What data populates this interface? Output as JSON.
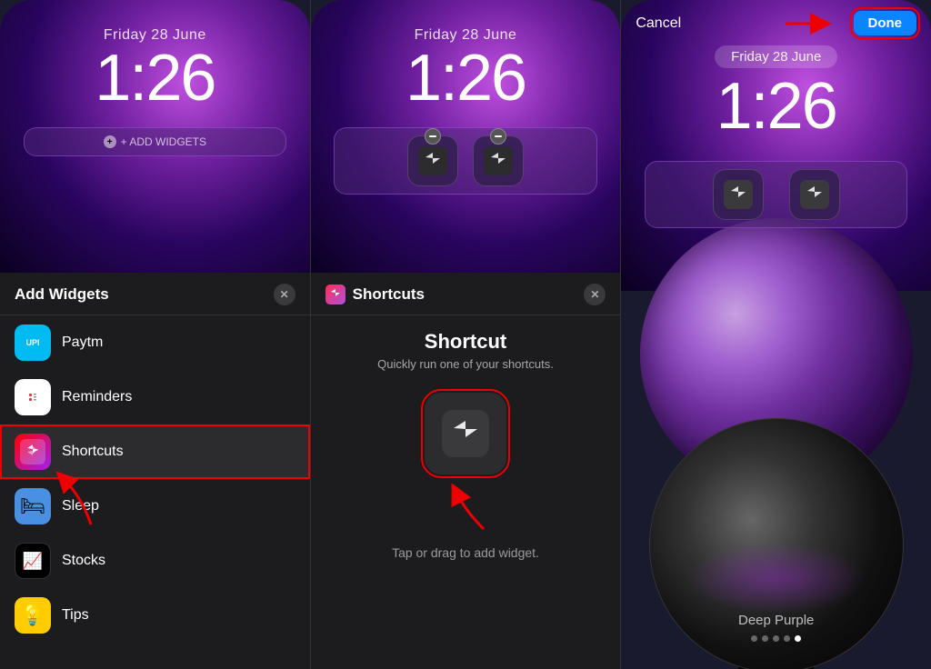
{
  "panels": [
    {
      "id": "panel1",
      "phone": {
        "date": "Friday 28 June",
        "time": "1:26",
        "widget_bar": "add_widgets"
      },
      "drawer": {
        "title": "Add Widgets",
        "items": [
          {
            "name": "Paytm",
            "icon_type": "paytm"
          },
          {
            "name": "Reminders",
            "icon_type": "reminders"
          },
          {
            "name": "Shortcuts",
            "icon_type": "shortcuts",
            "highlighted": true
          },
          {
            "name": "Sleep",
            "icon_type": "sleep"
          },
          {
            "name": "Stocks",
            "icon_type": "stocks"
          },
          {
            "name": "Tips",
            "icon_type": "tips"
          }
        ]
      }
    },
    {
      "id": "panel2",
      "phone": {
        "date": "Friday 28 June",
        "time": "1:26",
        "widget_bar": "shortcuts_icons"
      },
      "drawer": {
        "title": "Shortcuts",
        "shortcut_title": "Shortcut",
        "shortcut_desc": "Quickly run one of your shortcuts.",
        "tap_label": "Tap or drag to add widget."
      }
    },
    {
      "id": "panel3",
      "phone": {
        "date": "Friday 28 June",
        "time": "1:26",
        "widget_bar": "shortcuts_icons"
      },
      "top_bar": {
        "cancel": "Cancel",
        "done": "Done"
      },
      "wallpaper_label": "Deep Purple",
      "dots": [
        false,
        false,
        false,
        false,
        true
      ]
    }
  ],
  "add_widgets_label": "+ ADD WIDGETS"
}
